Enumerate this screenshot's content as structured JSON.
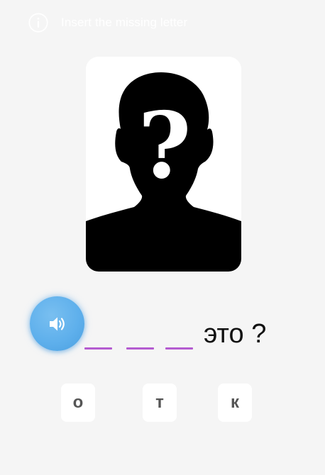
{
  "instruction": {
    "icon": "info-icon",
    "text": "Insert the missing letter"
  },
  "picture": {
    "icon": "unknown-person-silhouette",
    "glyph": "?"
  },
  "audio": {
    "icon": "speaker-icon",
    "accent_color": "#5fb0ec"
  },
  "sentence": {
    "blank_count": 3,
    "blank_color": "#b45bd0",
    "tail": "это ?"
  },
  "options": [
    {
      "letter": "о"
    },
    {
      "letter": "т"
    },
    {
      "letter": "к"
    }
  ]
}
